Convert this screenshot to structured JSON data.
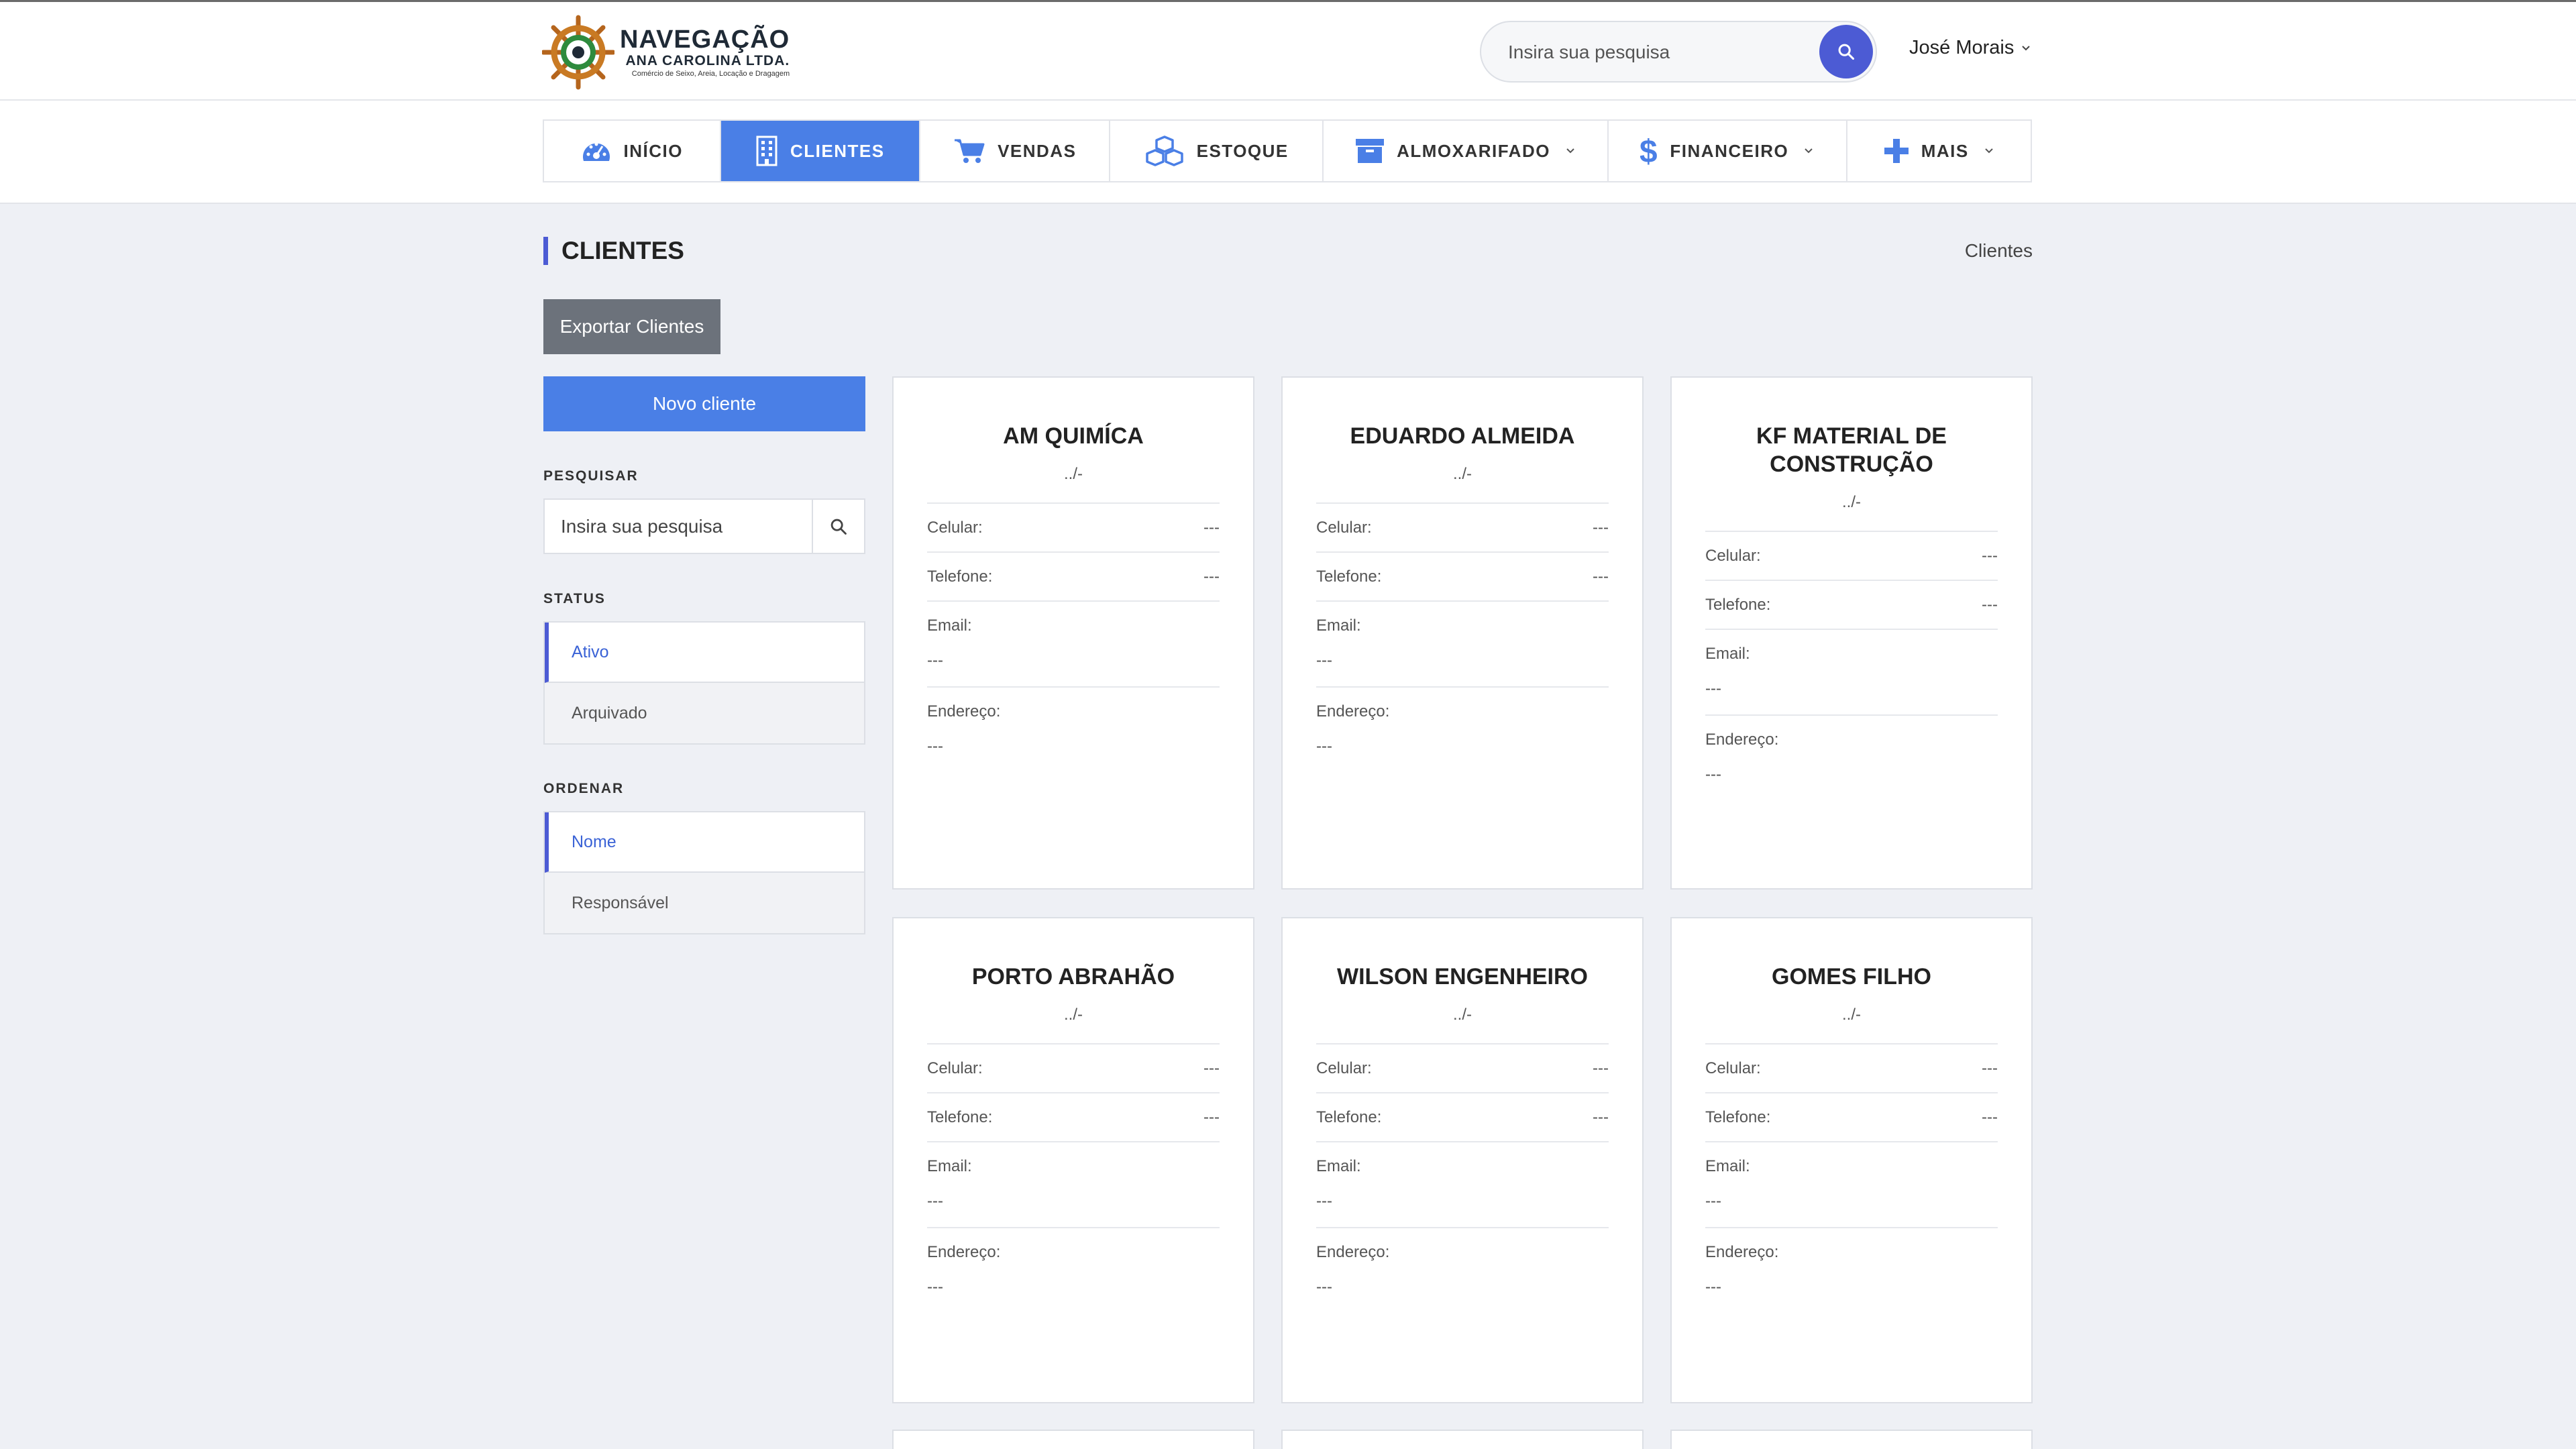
{
  "header": {
    "logo_title": "NAVEGAÇÃO",
    "logo_subtitle": "ANA CAROLINA LTDA.",
    "logo_tagline": "Comércio de Seixo, Areia, Locação e Dragagem",
    "search_placeholder": "Insira sua pesquisa",
    "user_name": "José Morais"
  },
  "nav": [
    {
      "label": "INÍCIO",
      "icon": "dashboard-icon"
    },
    {
      "label": "CLIENTES",
      "icon": "building-icon"
    },
    {
      "label": "VENDAS",
      "icon": "cart-icon"
    },
    {
      "label": "ESTOQUE",
      "icon": "cubes-icon"
    },
    {
      "label": "ALMOXARIFADO",
      "icon": "archive-icon"
    },
    {
      "label": "FINANCEIRO",
      "icon": "dollar-icon"
    },
    {
      "label": "MAIS",
      "icon": "plus-icon"
    }
  ],
  "page": {
    "title": "CLIENTES",
    "breadcrumb": "Clientes"
  },
  "sidebar": {
    "export_label": "Exportar Clientes",
    "new_label": "Novo cliente",
    "search_label": "PESQUISAR",
    "search_placeholder": "Insira sua pesquisa",
    "status_label": "STATUS",
    "status_options": [
      "Ativo",
      "Arquivado"
    ],
    "order_label": "ORDENAR",
    "order_options": [
      "Nome",
      "Responsável"
    ]
  },
  "field_labels": {
    "celular": "Celular:",
    "telefone": "Telefone:",
    "email": "Email:",
    "endereco": "Endereço:"
  },
  "clients": [
    {
      "name": "AM QUIMÍCA",
      "sub": "../-",
      "celular": "---",
      "telefone": "---",
      "email": "---",
      "endereco": "---"
    },
    {
      "name": "EDUARDO ALMEIDA",
      "sub": "../-",
      "celular": "---",
      "telefone": "---",
      "email": "---",
      "endereco": "---"
    },
    {
      "name": "KF MATERIAL DE CONSTRUÇÃO",
      "sub": "../-",
      "celular": "---",
      "telefone": "---",
      "email": "---",
      "endereco": "---"
    },
    {
      "name": "PORTO ABRAHÃO",
      "sub": "../-",
      "celular": "---",
      "telefone": "---",
      "email": "---",
      "endereco": "---"
    },
    {
      "name": "WILSON ENGENHEIRO",
      "sub": "../-",
      "celular": "---",
      "telefone": "---",
      "email": "---",
      "endereco": "---"
    },
    {
      "name": "GOMES FILHO",
      "sub": "../-",
      "celular": "---",
      "telefone": "---",
      "email": "---",
      "endereco": "---"
    }
  ],
  "colors": {
    "accent": "#4a7fe6",
    "indigo": "#4c5bd4",
    "export_button": "#6c727b",
    "page_background": "#eef0f5"
  }
}
